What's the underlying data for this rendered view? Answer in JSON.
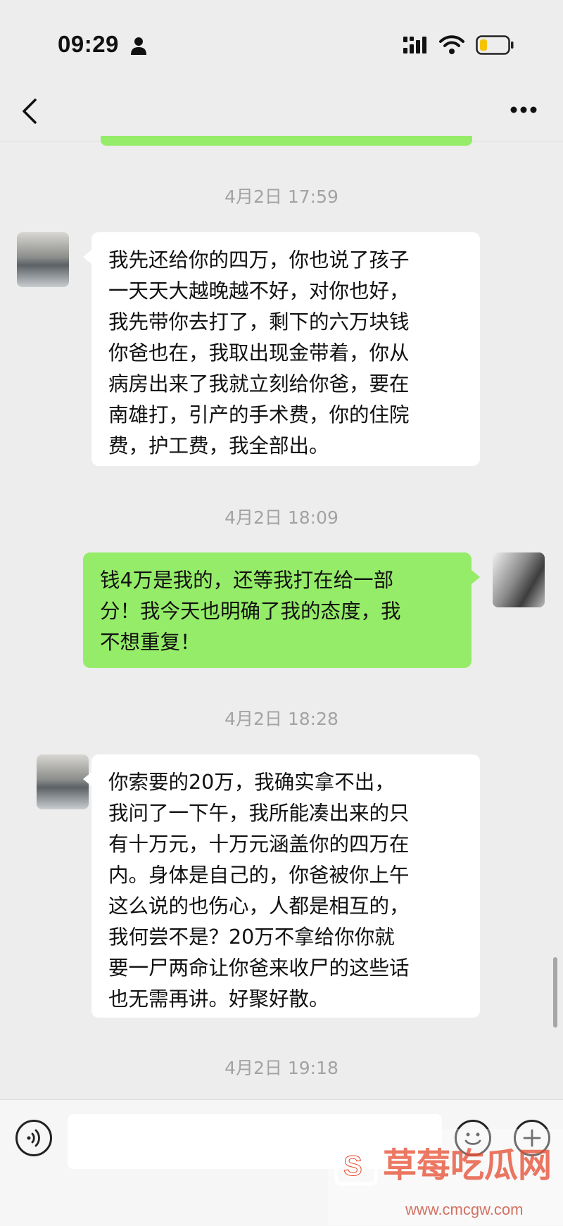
{
  "status_bar": {
    "time": "09:29",
    "icons": [
      "person-icon",
      "signal-icon",
      "wifi-icon",
      "battery-icon"
    ],
    "battery_color": "#f5c400"
  },
  "nav": {
    "back_icon": "chevron-left-icon",
    "title": "",
    "more_icon": "more-dots-icon"
  },
  "messages": [
    {
      "type": "timestamp",
      "text": "4月2日 17:59"
    },
    {
      "type": "received",
      "lines": [
        "我先还给你的四万，你也说了孩子",
        "一天天大越晚越不好，对你也好，",
        "我先带你去打了，剩下的六万块钱",
        "你爸也在，我取出现金带着，你从",
        "病房出来了我就立刻给你爸，要在",
        "南雄打，引产的手术费，你的住院",
        "费，护工费，我全部出。"
      ]
    },
    {
      "type": "timestamp",
      "text": "4月2日 18:09"
    },
    {
      "type": "sent",
      "lines": [
        "钱4万是我的，还等我打在给一部",
        "分！我今天也明确了我的态度，我",
        "不想重复！"
      ]
    },
    {
      "type": "timestamp",
      "text": "4月2日 18:28"
    },
    {
      "type": "received",
      "lines": [
        "你索要的20万，我确实拿不出，",
        "我问了一下午，我所能凑出来的只",
        "有十万元，十万元涵盖你的四万在",
        "内。身体是自己的，你爸被你上午",
        "这么说的也伤心，人都是相互的，",
        "我何尝不是？20万不拿给你你就",
        "要一尸两命让你爸来收尸的这些话",
        "也无需再讲。好聚好散。"
      ]
    },
    {
      "type": "timestamp",
      "text": "4月2日 19:18"
    }
  ],
  "input_bar": {
    "voice_icon": "voice-icon",
    "emoji_icon": "emoji-icon",
    "add_icon": "plus-icon"
  },
  "colors": {
    "sent_bubble": "#95ec69",
    "received_bubble": "#ffffff",
    "background": "#ededed",
    "timestamp": "#a3a3a3"
  },
  "watermark": {
    "text": "草莓吃瓜网",
    "url": "www.cmcgw.com"
  }
}
